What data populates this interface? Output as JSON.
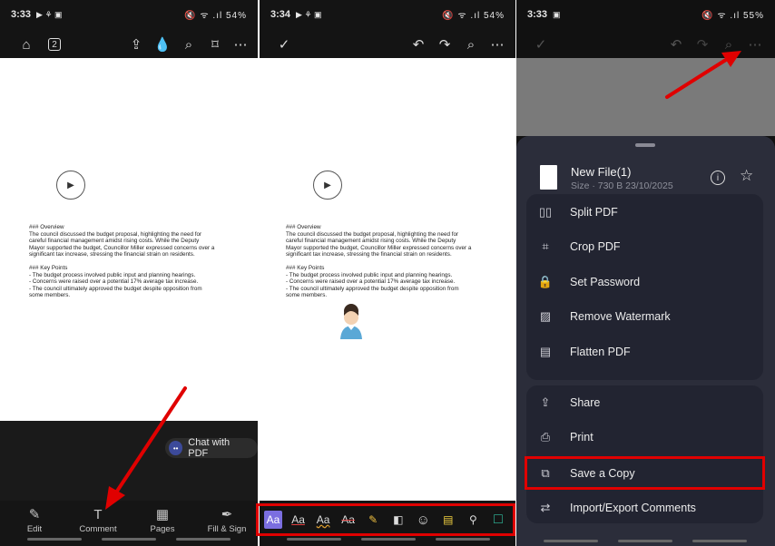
{
  "panel1": {
    "status": {
      "time": "3:33",
      "icons": "🔇 ᯤ .ıl 54%"
    },
    "toolbar": {
      "page_badge": "2"
    },
    "doc": {
      "heading1": "### Overview",
      "para1": "The council discussed the budget proposal, highlighting the need for careful financial management amidst rising costs. While the Deputy Mayor supported the budget, Councillor Miller expressed concerns over a significant tax increase, stressing the financial strain on residents.",
      "heading2": "### Key Points",
      "bullets": "- The budget process involved public input and planning hearings.\n- Concerns were raised over a potential 17% average tax increase.\n- The council ultimately approved the budget despite opposition from some members."
    },
    "chat_label": "Chat with PDF",
    "nav": [
      {
        "label": "Edit",
        "icon": "✎"
      },
      {
        "label": "Comment",
        "icon": "T"
      },
      {
        "label": "Pages",
        "icon": "▦"
      },
      {
        "label": "Fill & Sign",
        "icon": "✒"
      }
    ]
  },
  "panel2": {
    "status": {
      "time": "3:34",
      "icons": "🔇 ᯤ .ıl 54%"
    },
    "doc": {
      "heading1": "### Overview",
      "para1": "The council discussed the budget proposal, highlighting the need for careful financial management amidst rising costs. While the Deputy Mayor supported the budget, Councillor Miller expressed concerns over a significant tax increase, stressing the financial strain on residents.",
      "heading2": "### Key Points",
      "bullets": "- The budget process involved public input and planning hearings.\n- Concerns were raised over a potential 17% average tax increase.\n- The council ultimately approved the budget despite opposition from some members."
    },
    "tools": [
      {
        "name": "highlight-text-tool",
        "glyph": "Aa"
      },
      {
        "name": "underline-tool",
        "glyph": "Aa"
      },
      {
        "name": "squiggly-tool",
        "glyph": "Aa"
      },
      {
        "name": "strikethrough-tool",
        "glyph": "Aa"
      },
      {
        "name": "highlighter-pen-tool",
        "glyph": "✎"
      },
      {
        "name": "eraser-tool",
        "glyph": "◧"
      },
      {
        "name": "sticker-tool",
        "glyph": "☺"
      },
      {
        "name": "note-tool",
        "glyph": "▤"
      },
      {
        "name": "stamp-tool",
        "glyph": "⚲"
      },
      {
        "name": "shape-tool",
        "glyph": "□"
      }
    ]
  },
  "panel3": {
    "status": {
      "time": "3:33",
      "icons": "🔇 ᯤ .ıl 55%"
    },
    "file": {
      "name": "New File(1)",
      "meta": "Size · 730 B 23/10/2025"
    },
    "menu1": [
      {
        "label": "Split PDF",
        "icon": "▯▯"
      },
      {
        "label": "Crop PDF",
        "icon": "⌗"
      },
      {
        "label": "Set Password",
        "icon": "🔒"
      },
      {
        "label": "Remove Watermark",
        "icon": "▨"
      },
      {
        "label": "Flatten PDF",
        "icon": "▤"
      }
    ],
    "menu2": [
      {
        "label": "Share",
        "icon": "⇪"
      },
      {
        "label": "Print",
        "icon": "⎙"
      },
      {
        "label": "Save a Copy",
        "icon": "⧉"
      },
      {
        "label": "Import/Export Comments",
        "icon": "⇄"
      }
    ]
  },
  "colors": {
    "accent_red": "#e00000",
    "sheet_bg": "#2b2d3a",
    "card_bg": "#222431"
  }
}
